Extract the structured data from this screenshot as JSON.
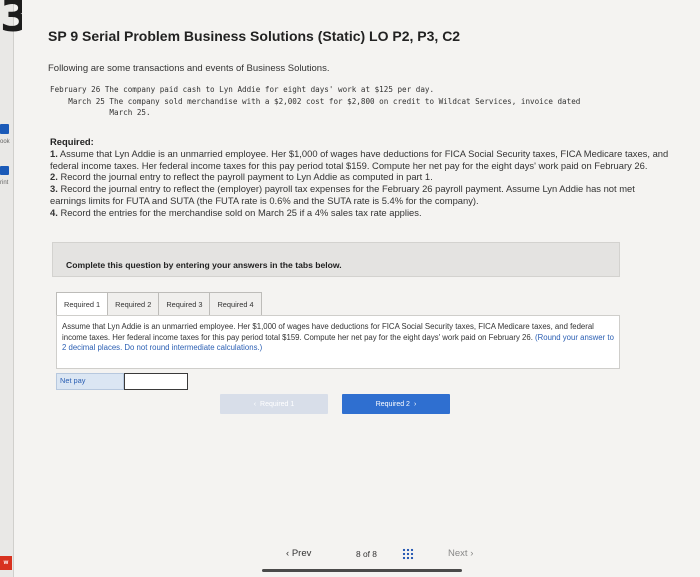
{
  "logo_fragment": "3",
  "sidebar": {
    "book_label": "ook",
    "print_label": "rint",
    "red_icon_label": "w"
  },
  "header": {
    "title": "SP 9 Serial Problem Business Solutions (Static) LO P2, P3, C2"
  },
  "intro": "Following are some transactions and events of Business Solutions.",
  "transactions": [
    "February 26 The company paid cash to Lyn Addie for eight days' work at $125 per day.",
    "    March 25 The company sold merchandise with a $2,002 cost for $2,800 on credit to Wildcat Services, invoice dated",
    "             March 25."
  ],
  "required": {
    "heading": "Required:",
    "items": [
      {
        "num": "1.",
        "text": "Assume that Lyn Addie is an unmarried employee. Her $1,000 of wages have deductions for FICA Social Security taxes, FICA Medicare taxes, and federal income taxes. Her federal income taxes for this pay period total $159. Compute her net pay for the eight days' work paid on February 26."
      },
      {
        "num": "2.",
        "text": "Record the journal entry to reflect the payroll payment to Lyn Addie as computed in part 1."
      },
      {
        "num": "3.",
        "text": "Record the journal entry to reflect the (employer) payroll tax expenses for the February 26 payroll payment. Assume Lyn Addie has not met earnings limits for FUTA and SUTA (the FUTA rate is 0.6% and the SUTA rate is 5.4% for the company)."
      },
      {
        "num": "4.",
        "text": "Record the entries for the merchandise sold on March 25 if a 4% sales tax rate applies."
      }
    ]
  },
  "instruction_box": "Complete this question by entering your answers in the tabs below.",
  "tabs": [
    "Required 1",
    "Required 2",
    "Required 3",
    "Required 4"
  ],
  "active_tab": 0,
  "panel": {
    "question": "Assume that Lyn Addie is an unmarried employee. Her $1,000 of wages have deductions for FICA Social Security taxes, FICA Medicare taxes, and federal income taxes. Her federal income taxes for this pay period total $159. Compute her net pay for the eight days' work paid on February 26.",
    "hint": "(Round your answer to 2 decimal places. Do not round intermediate calculations.)"
  },
  "answer": {
    "label": "Net pay",
    "value": ""
  },
  "tab_nav": {
    "prev_label": "Required 1",
    "next_label": "Required 2"
  },
  "pagination": {
    "prev_label": "Prev",
    "page_text": "8 of 8",
    "next_label": "Next"
  },
  "colors": {
    "accent": "#2f6fd0",
    "hint_blue": "#2b5fb3",
    "badge_red": "#d8321f"
  }
}
